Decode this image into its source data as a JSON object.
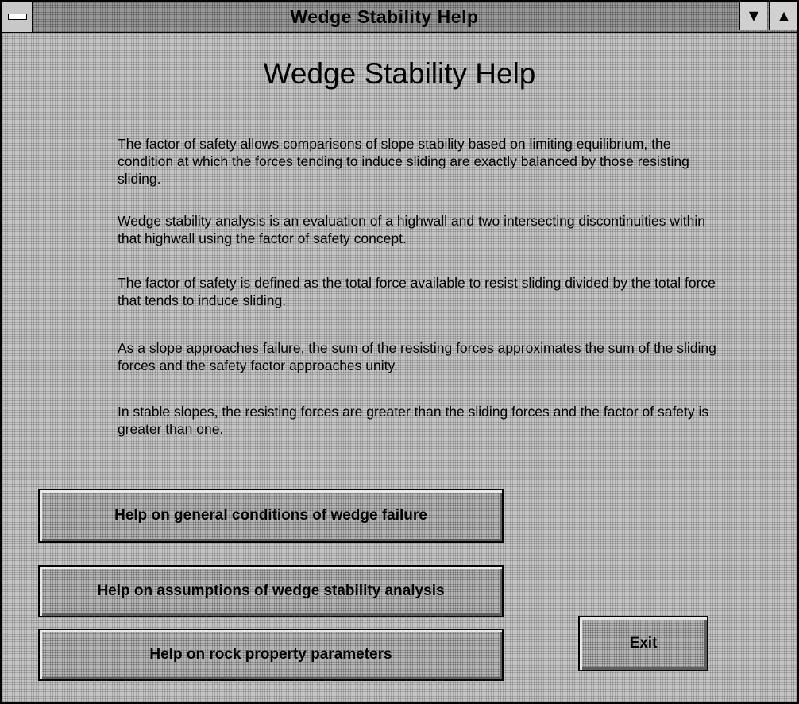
{
  "window": {
    "title": "Wedge Stability Help",
    "sysmenu_icon": "system-menu-icon",
    "minimize_icon": "triangle-down-icon",
    "maximize_icon": "triangle-up-icon",
    "minimize_glyph": "▼",
    "maximize_glyph": "▲"
  },
  "main": {
    "heading": "Wedge Stability Help",
    "paragraphs": [
      "The factor of safety allows comparisons of slope stability based on limiting equilibrium, the condition at which the forces tending to induce sliding are exactly balanced by those resisting sliding.",
      "Wedge stability analysis is an evaluation of a highwall and two intersecting discontinuities within that highwall using the factor of safety concept.",
      "The factor of safety is defined as the total force available to resist sliding divided by the total force that tends to induce sliding.",
      "As a slope approaches failure, the sum of the resisting forces  approximates the sum of the sliding forces and the safety factor approaches unity.",
      "In stable slopes, the resisting forces are greater than the sliding forces and the factor of safety is greater than one."
    ]
  },
  "buttons": {
    "general": "Help on general conditions of wedge failure",
    "assumptions": "Help on assumptions of wedge stability analysis",
    "rock": "Help on rock property parameters",
    "exit": "Exit"
  },
  "colors": {
    "window_bg": "#c4c4c4",
    "titlebar_bg": "#9a9a9a",
    "border": "#000000"
  }
}
